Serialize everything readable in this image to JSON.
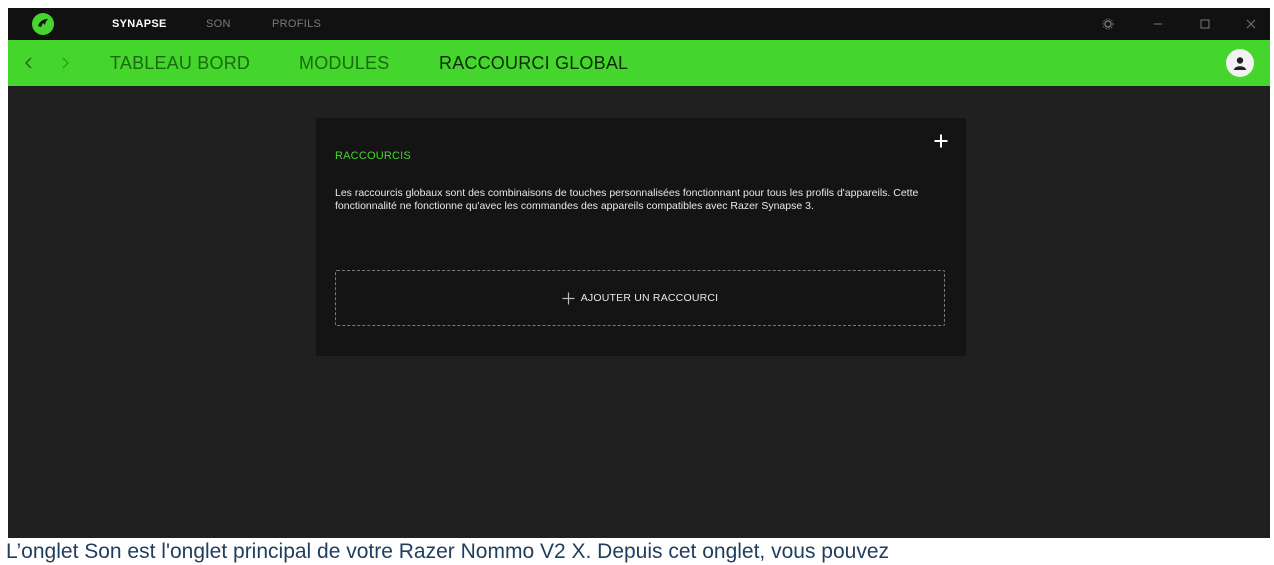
{
  "titlebar": {
    "tabs": [
      {
        "label": "SYNAPSE",
        "active": true
      },
      {
        "label": "SON",
        "active": false
      },
      {
        "label": "PROFILS",
        "active": false
      }
    ],
    "controls": [
      "settings-icon",
      "minimize-icon",
      "maximize-icon",
      "close-icon"
    ]
  },
  "navbar": {
    "tabs": [
      {
        "label": "TABLEAU BORD",
        "active": false
      },
      {
        "label": "MODULES",
        "active": false
      },
      {
        "label": "RACCOURCI GLOBAL",
        "active": true
      }
    ]
  },
  "card": {
    "title": "RACCOURCIS",
    "description": "Les raccourcis globaux sont des combinaisons de touches personnalisées fonctionnant pour tous les profils d'appareils. Cette fonctionnalité ne fonctionne qu'avec les commandes des appareils compatibles avec Razer Synapse 3.",
    "add_button_label": "AJOUTER UN RACCOURCI"
  },
  "caption": "L’onglet Son est l'onglet principal de votre Razer Nommo V2 X. Depuis cet onglet, vous pouvez",
  "colors": {
    "accent": "#44d62c",
    "background": "#202020",
    "card": "#141414",
    "titlebar": "#111111"
  }
}
